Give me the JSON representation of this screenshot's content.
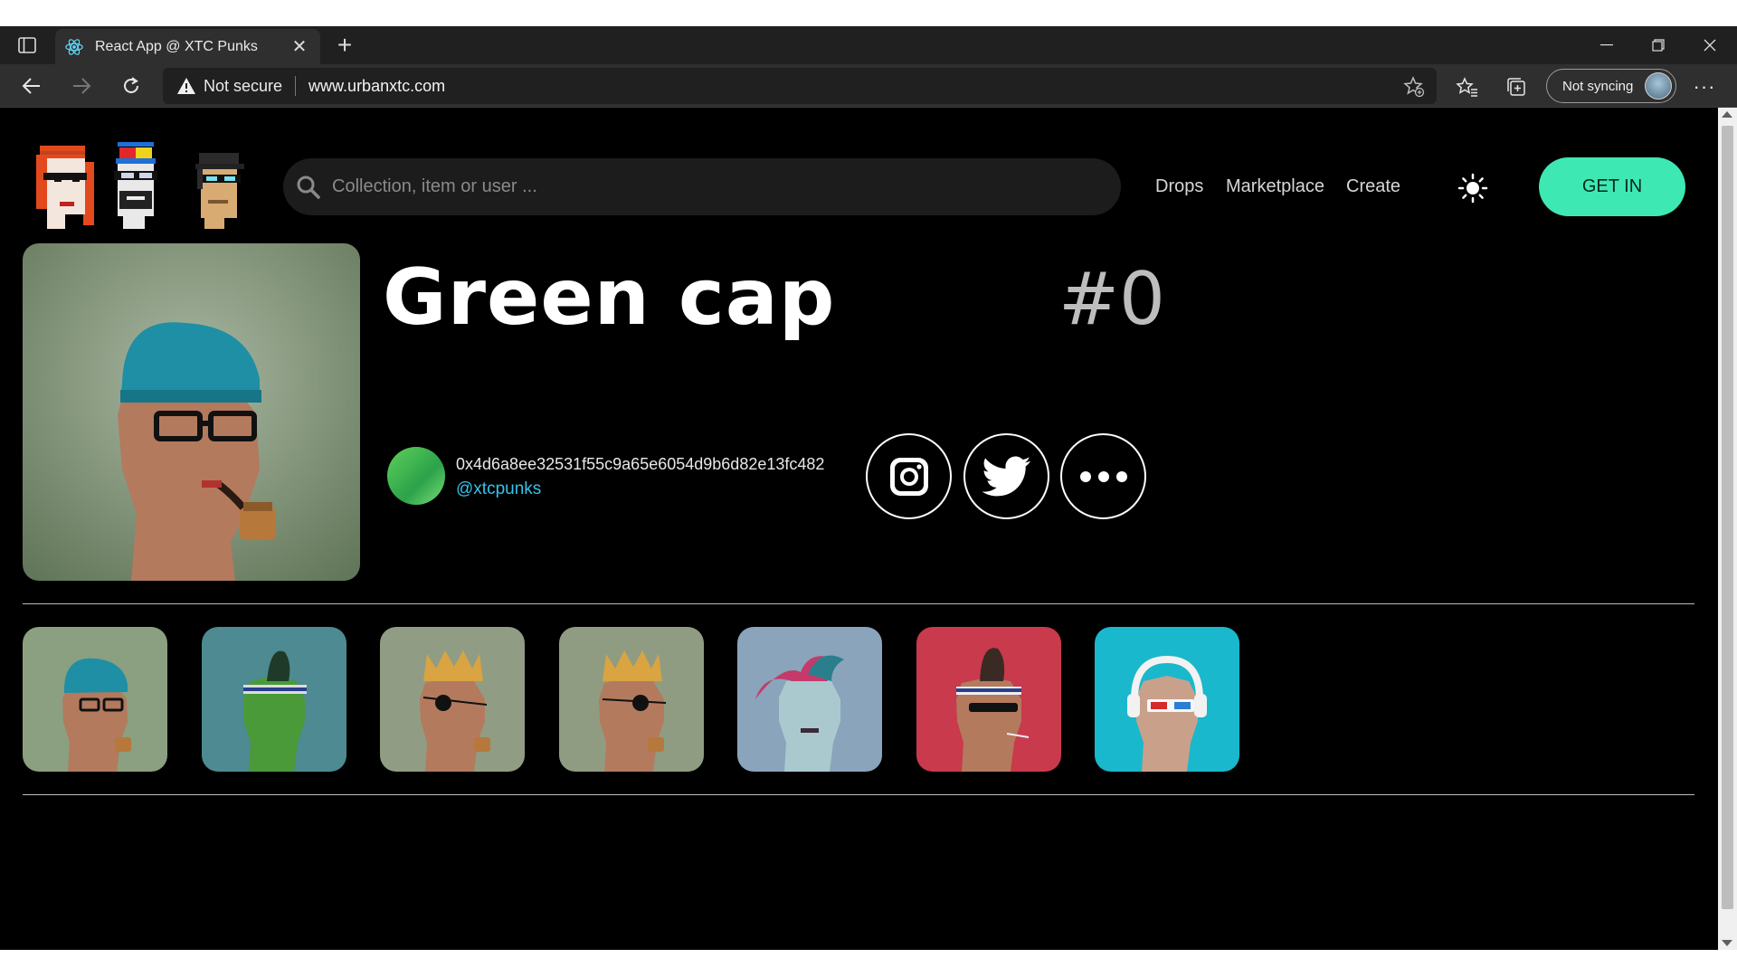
{
  "browser": {
    "tab_title": "React App @ XTC Punks",
    "not_secure_label": "Not secure",
    "url": "www.urbanxtc.com",
    "sync_label": "Not syncing",
    "more_label": "···"
  },
  "header": {
    "search_placeholder": "Collection, item or user ...",
    "nav": [
      "Drops",
      "Marketplace",
      "Create"
    ],
    "cta_label": "GET IN",
    "accent_color": "#3ee8b3"
  },
  "item": {
    "title": "Green cap",
    "number": "#0",
    "owner_address": "0x4d6a8ee32531f55c9a65e6054d9b6d82e13fc482",
    "owner_handle": "@xtcpunks",
    "social": [
      "instagram-icon",
      "twitter-icon",
      "more-icon"
    ]
  },
  "gallery": {
    "count": 7,
    "items": [
      {
        "desc": "green cap, glasses, pipe",
        "bg": "#8aa080"
      },
      {
        "desc": "green skin, mohawk, headband",
        "bg": "#4d8a92"
      },
      {
        "desc": "crown, eyepatch, pipe",
        "bg": "#909d84"
      },
      {
        "desc": "crown, eyepatch, pipe",
        "bg": "#8f9c82"
      },
      {
        "desc": "pink hair, blue skin",
        "bg": "#8aa4bb"
      },
      {
        "desc": "mohawk, sunglasses, red bg",
        "bg": "#c93a4c"
      },
      {
        "desc": "headphones, 3d glasses",
        "bg": "#1ab8cc"
      }
    ]
  }
}
